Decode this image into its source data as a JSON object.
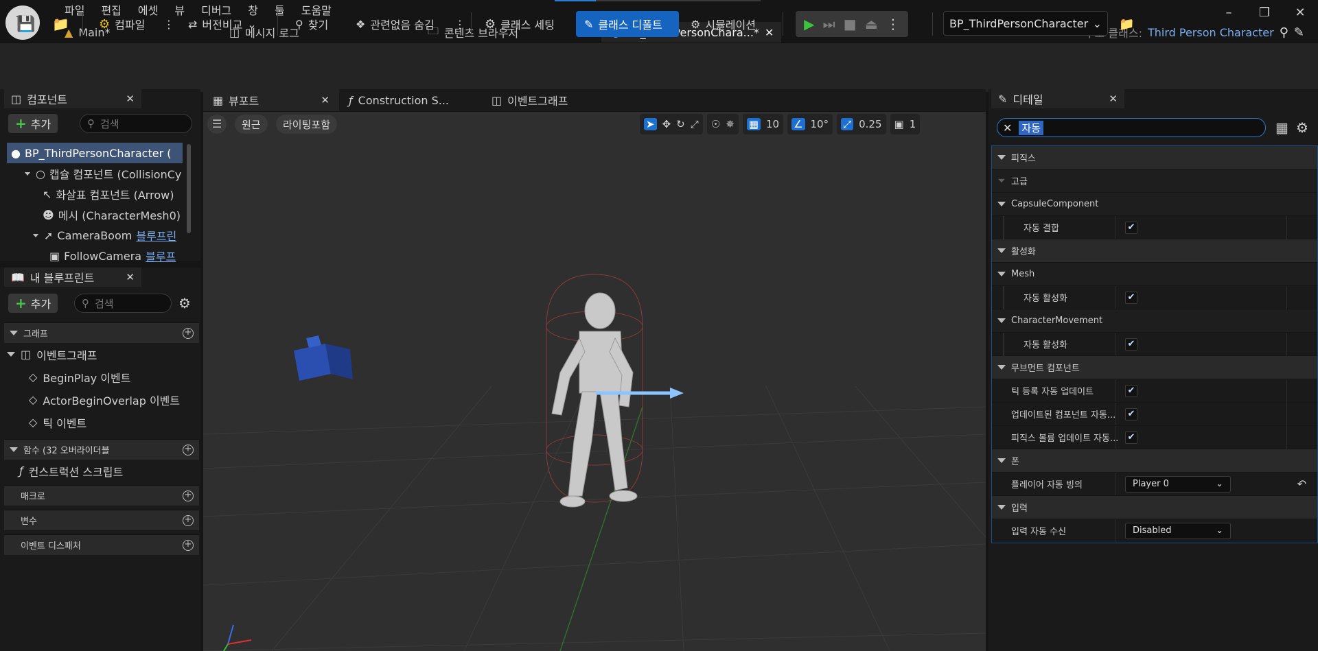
{
  "menu": [
    "파일",
    "편집",
    "에셋",
    "뷰",
    "디버그",
    "창",
    "툴",
    "도움말"
  ],
  "doc_tabs": [
    {
      "label": "Main*"
    },
    {
      "label": "메시지 로그"
    },
    {
      "label": "콘텐츠 브라우저"
    },
    {
      "label": "BP_ThirdPersonChara...*"
    }
  ],
  "parent_class": {
    "label": "부모 클래스:",
    "value": "Third Person Character"
  },
  "toolbar": {
    "compile": "컴파일",
    "diff": "버전비교",
    "find": "찾기",
    "hide_unrelated": "관련없음 숨김",
    "class_settings": "클래스 세팅",
    "class_defaults": "클래스 디폴트",
    "simulation": "시뮬레이션",
    "blueprint_select": "BP_ThirdPersonCharacter"
  },
  "components": {
    "tab": "컴포넌트",
    "add": "추가",
    "search_placeholder": "검색",
    "tree": [
      {
        "label": "BP_ThirdPersonCharacter (",
        "link": ""
      },
      {
        "label": "캡슐 컴포넌트 (CollisionCy",
        "link": ""
      },
      {
        "label": "화살표 컴포넌트 (Arrow)",
        "link": ""
      },
      {
        "label": "메시 (CharacterMesh0)",
        "link": ""
      },
      {
        "label": "CameraBoom",
        "link": "블루프린"
      },
      {
        "label": "FollowCamera",
        "link": "블루프"
      }
    ]
  },
  "my_blueprint": {
    "tab": "내 블루프린트",
    "add": "추가",
    "search_placeholder": "검색",
    "graphs_header": "그래프",
    "event_graph": "이벤트그래프",
    "events": [
      "BeginPlay 이벤트",
      "ActorBeginOverlap 이벤트",
      "틱 이벤트"
    ],
    "functions_header": "함수 (32 오버라이더블",
    "construction_script": "컨스트럭션 스크립트",
    "macros_header": "매크로",
    "variables_header": "변수",
    "dispatchers_header": "이벤트 디스패처"
  },
  "viewport": {
    "tabs": [
      "뷰포트",
      "Construction S...",
      "이벤트그래프"
    ],
    "perspective": "원근",
    "lighting": "라이팅포함",
    "grid_snap": "10",
    "rot_snap": "10°",
    "scale_snap": "0.25",
    "camera_speed": "1"
  },
  "details": {
    "tab": "디테일",
    "search_value": "자동",
    "rows": [
      {
        "kind": "cat",
        "label": "피직스"
      },
      {
        "kind": "sub",
        "label": "고급"
      },
      {
        "kind": "sub",
        "label": "CapsuleComponent"
      },
      {
        "kind": "check",
        "label": "자동 결합"
      },
      {
        "kind": "cat",
        "label": "활성화"
      },
      {
        "kind": "sub",
        "label": "Mesh"
      },
      {
        "kind": "check",
        "label": "자동 활성화"
      },
      {
        "kind": "sub",
        "label": "CharacterMovement"
      },
      {
        "kind": "check",
        "label": "자동 활성화"
      },
      {
        "kind": "cat",
        "label": "무브먼트 컴포넌트"
      },
      {
        "kind": "flatcheck",
        "label": "틱 등록 자동 업데이트"
      },
      {
        "kind": "flatcheck",
        "label": "업데이트된 컴포넌트 자동..."
      },
      {
        "kind": "flatcheck",
        "label": "피직스 볼륨 업데이트 자동..."
      },
      {
        "kind": "cat",
        "label": "폰"
      },
      {
        "kind": "dropdown",
        "label": "플레이어 자동 빙의",
        "value": "Player 0"
      },
      {
        "kind": "cat",
        "label": "입력"
      },
      {
        "kind": "dropdown",
        "label": "입력 자동 수신",
        "value": "Disabled"
      }
    ]
  },
  "colors": {
    "accent": "#1565c0",
    "selection": "#3e5476",
    "link": "#7aaef0",
    "play": "#3cc43c"
  }
}
